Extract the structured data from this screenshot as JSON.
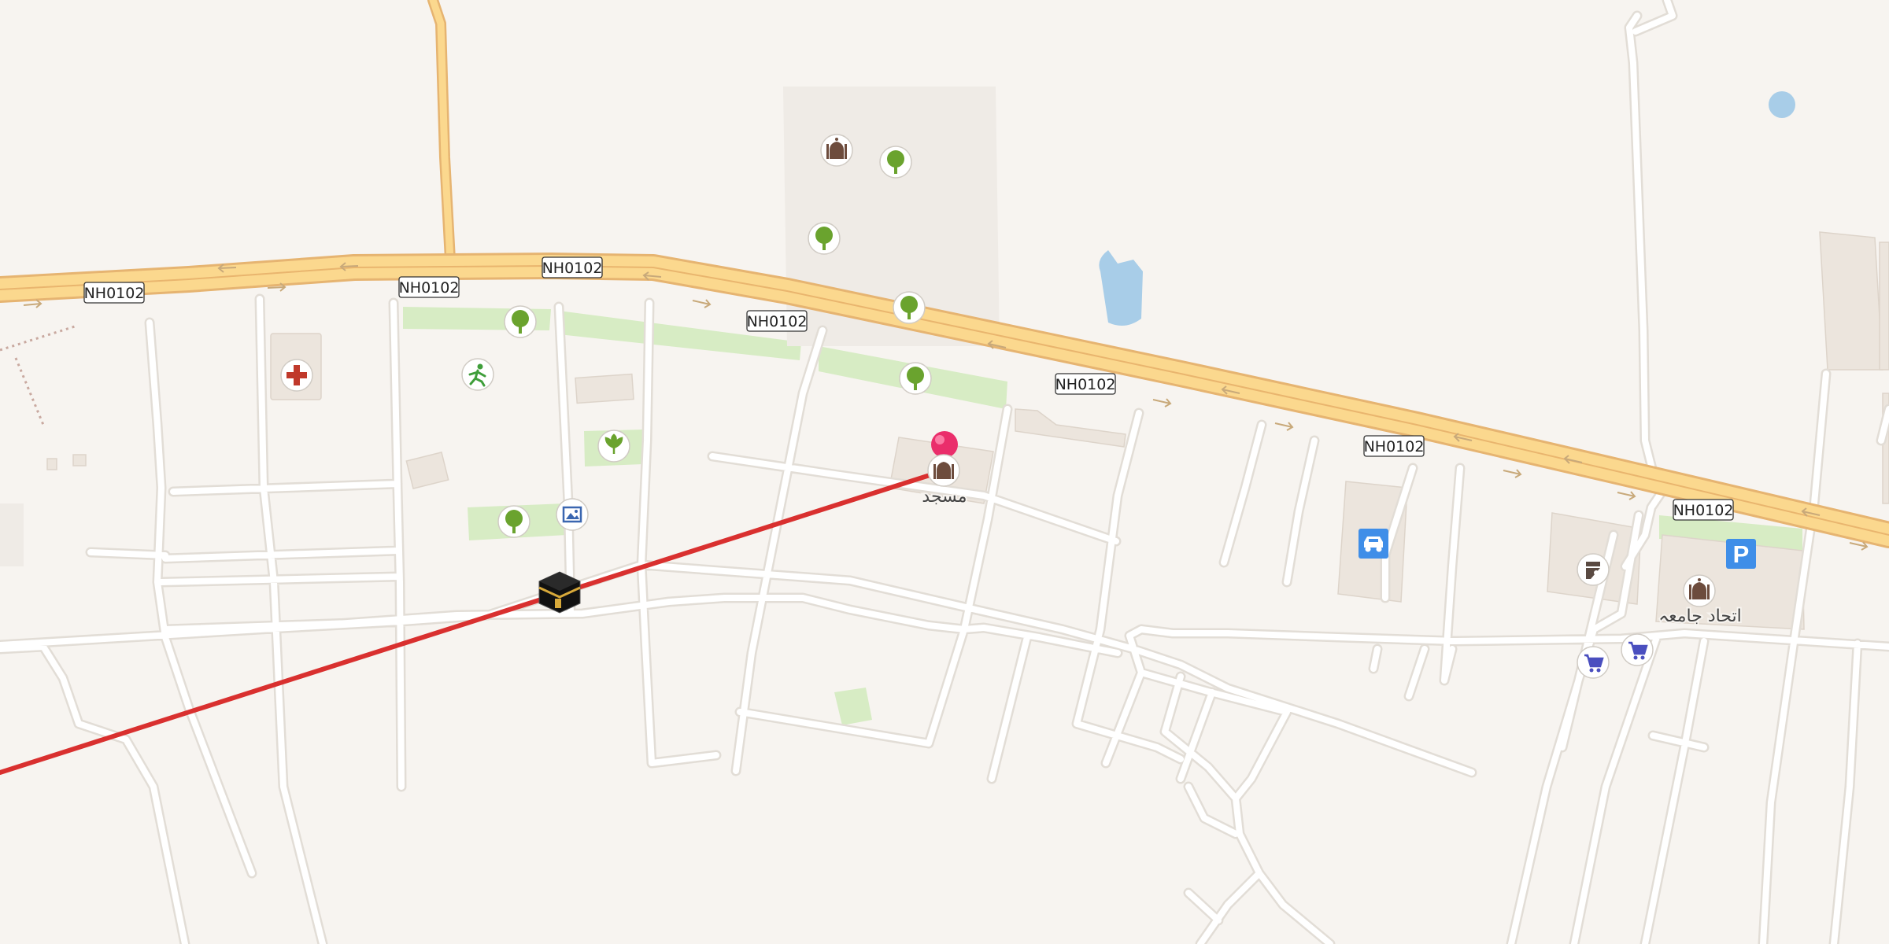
{
  "map": {
    "road_labels": [
      "NH0102",
      "NH0102",
      "NH0102",
      "NH0102",
      "NH0102",
      "NH0102",
      "NH0102"
    ],
    "place_labels": {
      "mosque": "مسجد",
      "jamia_mosque": "اتحاد جامعہ"
    },
    "icons": {
      "destination_pin": "map-pin-icon",
      "kaaba": "kaaba-icon",
      "hospital": "hospital-icon",
      "sports": "sports-icon",
      "park": "tree-icon",
      "garden": "garden-icon",
      "gallery": "gallery-icon",
      "mosque": "mosque-icon",
      "car": "car-dealer-icon",
      "parking": "parking-icon",
      "shop": "shopping-cart-icon",
      "toilets": "toilets-icon"
    },
    "colors": {
      "background": "#f7f4f0",
      "highway_fill": "#fbd88e",
      "highway_casing": "#e6b471",
      "street": "#ffffff",
      "street_casing": "#e2ddd6",
      "park": "#d7ecc4",
      "water": "#a8cde8",
      "building": "#ece5dd",
      "qibla_line": "#d9302f",
      "pin": "#ea2e6b"
    }
  }
}
